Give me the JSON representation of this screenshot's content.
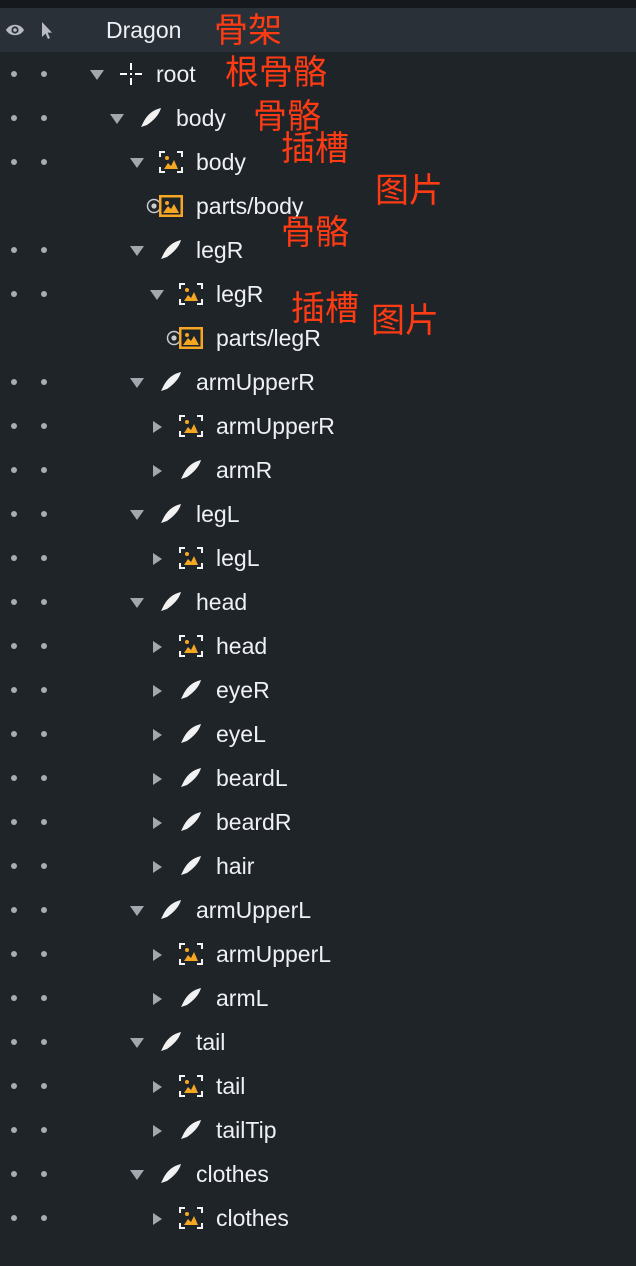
{
  "header": {
    "title": "Dragon",
    "annotation": "骨架",
    "eye_icon": "eye-icon",
    "cursor_icon": "cursor-icon"
  },
  "nodes": [
    {
      "label": "root",
      "type": "root",
      "expander": "expanded",
      "annotation": "根骨骼"
    },
    {
      "label": "body",
      "type": "bone",
      "expander": "expanded",
      "annotation": "骨骼"
    },
    {
      "label": "body",
      "type": "slot",
      "expander": "expanded",
      "annotation": "插槽"
    },
    {
      "label": "parts/body",
      "type": "image",
      "expander": "none",
      "annotation": "图片"
    },
    {
      "label": "legR",
      "type": "bone",
      "expander": "expanded",
      "annotation": "骨骼"
    },
    {
      "label": "legR",
      "type": "slot",
      "expander": "expanded",
      "annotation": "插槽"
    },
    {
      "label": "parts/legR",
      "type": "image",
      "expander": "none",
      "annotation": "图片"
    },
    {
      "label": "armUpperR",
      "type": "bone",
      "expander": "expanded"
    },
    {
      "label": "armUpperR",
      "type": "slot",
      "expander": "collapsed"
    },
    {
      "label": "armR",
      "type": "bone",
      "expander": "collapsed"
    },
    {
      "label": "legL",
      "type": "bone",
      "expander": "expanded"
    },
    {
      "label": "legL",
      "type": "slot",
      "expander": "collapsed"
    },
    {
      "label": "head",
      "type": "bone",
      "expander": "expanded"
    },
    {
      "label": "head",
      "type": "slot",
      "expander": "collapsed"
    },
    {
      "label": "eyeR",
      "type": "bone",
      "expander": "collapsed"
    },
    {
      "label": "eyeL",
      "type": "bone",
      "expander": "collapsed"
    },
    {
      "label": "beardL",
      "type": "bone",
      "expander": "collapsed"
    },
    {
      "label": "beardR",
      "type": "bone",
      "expander": "collapsed"
    },
    {
      "label": "hair",
      "type": "bone",
      "expander": "collapsed"
    },
    {
      "label": "armUpperL",
      "type": "bone",
      "expander": "expanded"
    },
    {
      "label": "armUpperL",
      "type": "slot",
      "expander": "collapsed"
    },
    {
      "label": "armL",
      "type": "bone",
      "expander": "collapsed"
    },
    {
      "label": "tail",
      "type": "bone",
      "expander": "expanded"
    },
    {
      "label": "tail",
      "type": "slot",
      "expander": "collapsed"
    },
    {
      "label": "tailTip",
      "type": "bone",
      "expander": "collapsed"
    },
    {
      "label": "clothes",
      "type": "bone",
      "expander": "expanded"
    },
    {
      "label": "clothes",
      "type": "slot",
      "expander": "collapsed"
    }
  ],
  "colors": {
    "background": "#1f2429",
    "header_background": "#2a3038",
    "text": "#eef0f3",
    "annotation": "#ff3b14",
    "slot_icon": "#f5a623",
    "image_icon": "#f5a623",
    "bone_icon": "#f2f2f2"
  }
}
